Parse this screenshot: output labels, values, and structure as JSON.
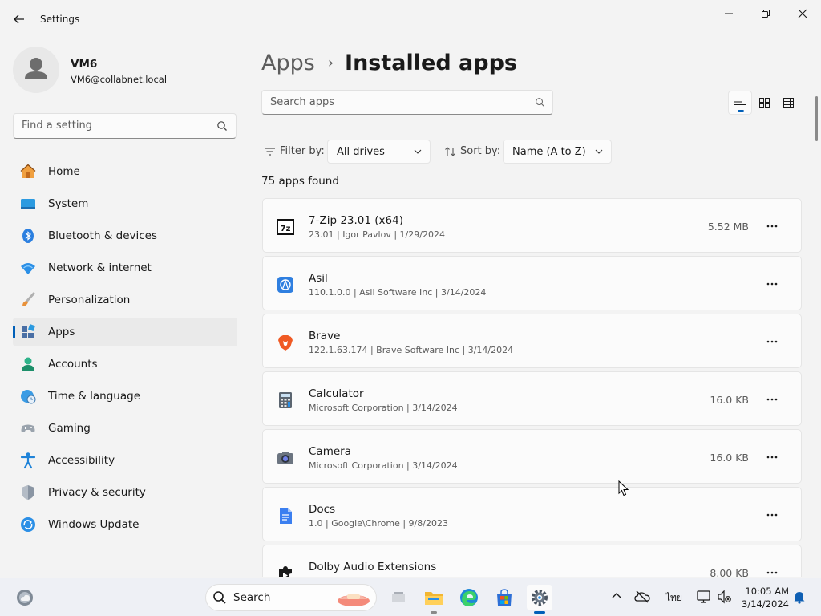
{
  "window": {
    "title": "Settings"
  },
  "profile": {
    "name": "VM6",
    "email": "VM6@collabnet.local"
  },
  "sidebar": {
    "search_placeholder": "Find a setting",
    "items": [
      {
        "label": "Home",
        "icon": "home-icon"
      },
      {
        "label": "System",
        "icon": "system-icon"
      },
      {
        "label": "Bluetooth & devices",
        "icon": "bluetooth-icon"
      },
      {
        "label": "Network & internet",
        "icon": "wifi-icon"
      },
      {
        "label": "Personalization",
        "icon": "brush-icon"
      },
      {
        "label": "Apps",
        "icon": "apps-icon",
        "active": true
      },
      {
        "label": "Accounts",
        "icon": "accounts-icon"
      },
      {
        "label": "Time & language",
        "icon": "globe-clock-icon"
      },
      {
        "label": "Gaming",
        "icon": "gamepad-icon"
      },
      {
        "label": "Accessibility",
        "icon": "accessibility-icon"
      },
      {
        "label": "Privacy & security",
        "icon": "shield-icon"
      },
      {
        "label": "Windows Update",
        "icon": "update-icon"
      }
    ]
  },
  "main": {
    "breadcrumb": {
      "parent": "Apps",
      "separator": "›",
      "current": "Installed apps"
    },
    "search_placeholder": "Search apps",
    "filter": {
      "label": "Filter by:",
      "value": "All drives"
    },
    "sort": {
      "label": "Sort by:",
      "value": "Name (A to Z)"
    },
    "count_text": "75 apps found",
    "apps": [
      {
        "name": "7-Zip 23.01 (x64)",
        "meta": "23.01  |  Igor Pavlov  |  1/29/2024",
        "size": "5.52 MB",
        "icon": "7zip-icon"
      },
      {
        "name": "Asil",
        "meta": "110.1.0.0  |  Asil Software Inc  |  3/14/2024",
        "size": "",
        "icon": "asil-icon"
      },
      {
        "name": "Brave",
        "meta": "122.1.63.174  |  Brave Software Inc  |  3/14/2024",
        "size": "",
        "icon": "brave-icon"
      },
      {
        "name": "Calculator",
        "meta": "Microsoft Corporation  |  3/14/2024",
        "size": "16.0 KB",
        "icon": "calculator-icon"
      },
      {
        "name": "Camera",
        "meta": "Microsoft Corporation  |  3/14/2024",
        "size": "16.0 KB",
        "icon": "camera-icon"
      },
      {
        "name": "Docs",
        "meta": "1.0  |  Google\\Chrome  |  9/8/2023",
        "size": "",
        "icon": "docs-icon"
      },
      {
        "name": "Dolby Audio Extensions",
        "meta": "",
        "size": "8.00 KB",
        "icon": "puzzle-icon"
      }
    ]
  },
  "taskbar": {
    "search_label": "Search",
    "language": "ไทย",
    "time": "10:05 AM",
    "date": "3/14/2024"
  },
  "colors": {
    "accent": "#005fb8",
    "background": "#f3f3f3",
    "card": "#fbfbfb"
  }
}
